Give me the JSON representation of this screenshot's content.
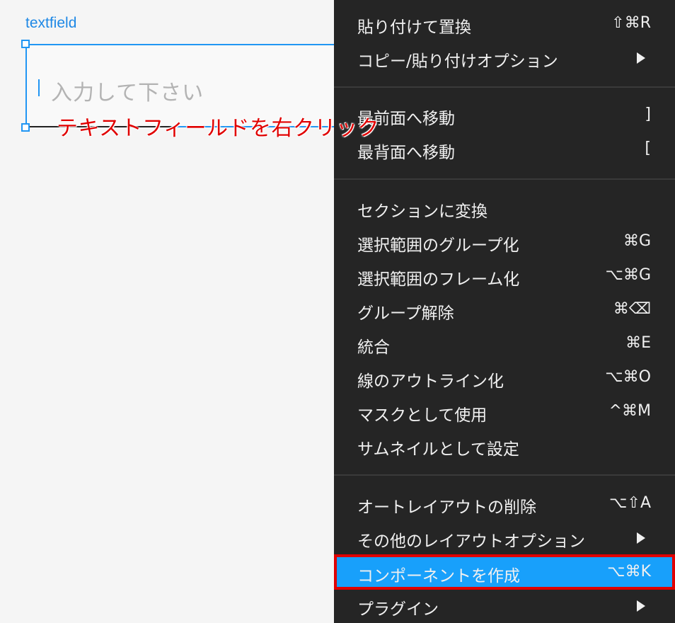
{
  "canvas": {
    "frame_label": "textfield",
    "textfield_placeholder": "入力して下さい"
  },
  "annotation": {
    "text": "テキストフィールドを右クリック",
    "color": "#e00000"
  },
  "menu": {
    "items": [
      {
        "label": "貼り付けて置換",
        "shortcut": "⇧⌘R"
      },
      {
        "label": "コピー/貼り付けオプション",
        "submenu": true
      },
      {
        "label": "最前面へ移動",
        "shortcut": "]"
      },
      {
        "label": "最背面へ移動",
        "shortcut": "["
      },
      {
        "label": "セクションに変換"
      },
      {
        "label": "選択範囲のグループ化",
        "shortcut": "⌘G"
      },
      {
        "label": "選択範囲のフレーム化",
        "shortcut": "⌥⌘G"
      },
      {
        "label": "グループ解除",
        "shortcut": "⌘⌫"
      },
      {
        "label": "統合",
        "shortcut": "⌘E"
      },
      {
        "label": "線のアウトライン化",
        "shortcut": "⌥⌘O"
      },
      {
        "label": "マスクとして使用",
        "shortcut": "^⌘M"
      },
      {
        "label": "サムネイルとして設定"
      },
      {
        "label": "オートレイアウトの削除",
        "shortcut": "⌥⇧A"
      },
      {
        "label": "その他のレイアウトオプション",
        "submenu": true
      },
      {
        "label": "コンポーネントを作成",
        "shortcut": "⌥⌘K",
        "active": true
      },
      {
        "label": "プラグイン",
        "submenu": true
      }
    ]
  },
  "colors": {
    "accent": "#18a0fb",
    "selection": "#2196f3",
    "menu_bg": "#252525",
    "annotation": "#e00000"
  }
}
